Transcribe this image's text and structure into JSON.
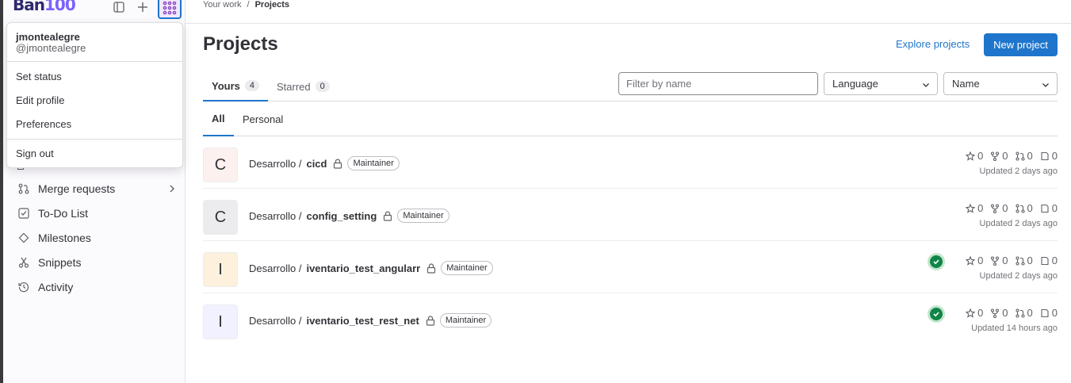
{
  "sidebar": {
    "logo_main": "Ban",
    "logo_alt": "100",
    "icons": [
      "sidebar-toggle-icon",
      "plus-icon"
    ],
    "nav": [
      {
        "label": "Merge requests",
        "icon": "merge-request-icon",
        "has_chevron": true
      },
      {
        "label": "To-Do List",
        "icon": "todo-icon"
      },
      {
        "label": "Milestones",
        "icon": "milestone-icon"
      },
      {
        "label": "Snippets",
        "icon": "snippet-icon"
      },
      {
        "label": "Activity",
        "icon": "history-icon"
      }
    ]
  },
  "user_menu": {
    "name": "jmontealegre",
    "handle": "@jmontealegre",
    "items": [
      "Set status",
      "Edit profile",
      "Preferences"
    ],
    "sign_out": "Sign out"
  },
  "breadcrumb": {
    "items": [
      "Your work",
      "Projects"
    ],
    "separator": "/"
  },
  "page": {
    "title": "Projects",
    "explore_link": "Explore projects",
    "new_button": "New project"
  },
  "tabs": [
    {
      "label": "Yours",
      "count": "4",
      "active": true
    },
    {
      "label": "Starred",
      "count": "0",
      "active": false
    }
  ],
  "filter": {
    "placeholder": "Filter by name"
  },
  "language_select": {
    "value": "Language"
  },
  "sort_select": {
    "value": "Name"
  },
  "subtabs": [
    {
      "label": "All",
      "active": true
    },
    {
      "label": "Personal",
      "active": false
    }
  ],
  "projects": [
    {
      "initial": "C",
      "namespace": "Desarrollo /",
      "name": "cicd",
      "role": "Maintainer",
      "stars": "0",
      "forks": "0",
      "mrs": "0",
      "issues": "0",
      "updated": "Updated 2 days ago",
      "pipeline": false,
      "avatar_color": "#fcf1ef"
    },
    {
      "initial": "C",
      "namespace": "Desarrollo /",
      "name": "config_setting",
      "role": "Maintainer",
      "stars": "0",
      "forks": "0",
      "mrs": "0",
      "issues": "0",
      "updated": "Updated 2 days ago",
      "pipeline": false,
      "avatar_color": "#ececef"
    },
    {
      "initial": "I",
      "namespace": "Desarrollo /",
      "name": "iventario_test_angularr",
      "role": "Maintainer",
      "stars": "0",
      "forks": "0",
      "mrs": "0",
      "issues": "0",
      "updated": "Updated 2 days ago",
      "pipeline": true,
      "avatar_color": "#fdf1dd"
    },
    {
      "initial": "I",
      "namespace": "Desarrollo /",
      "name": "iventario_test_rest_net",
      "role": "Maintainer",
      "stars": "0",
      "forks": "0",
      "mrs": "0",
      "issues": "0",
      "updated": "Updated 14 hours ago",
      "pipeline": true,
      "avatar_color": "#f1f1ff"
    }
  ],
  "colors": {
    "accent": "#1f75cb",
    "success": "#108548"
  }
}
